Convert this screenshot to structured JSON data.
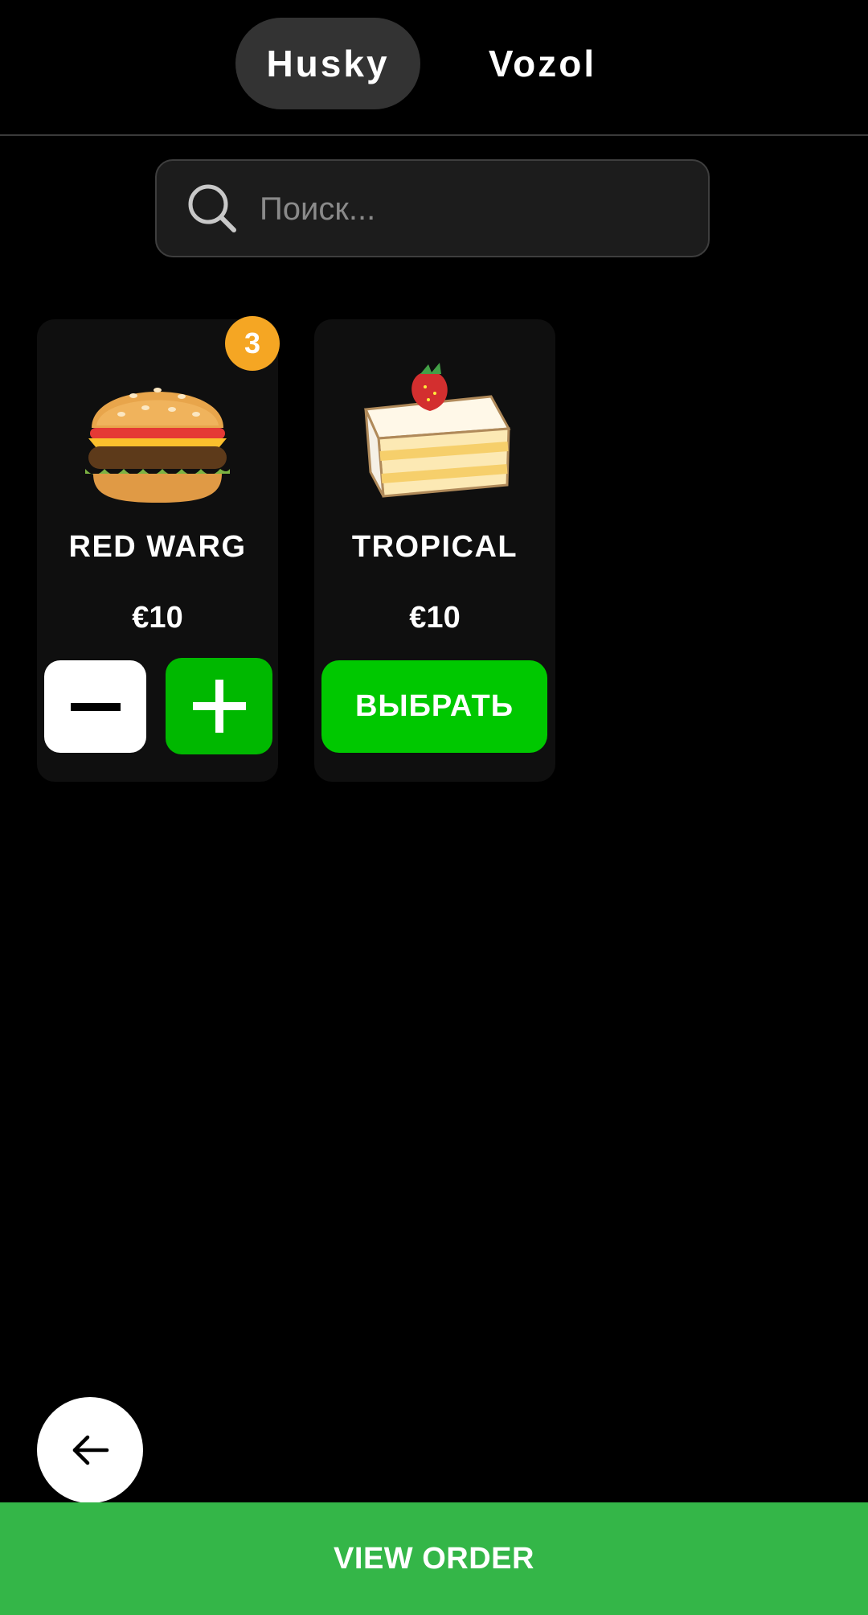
{
  "tabs": [
    {
      "label": "Husky",
      "active": true
    },
    {
      "label": "Vozol",
      "active": false
    }
  ],
  "search": {
    "placeholder": "Поиск...",
    "value": ""
  },
  "products": [
    {
      "name": "RED WARG",
      "price": "€10",
      "image": "burger",
      "quantity": "3",
      "action": "stepper"
    },
    {
      "name": "TROPICAL",
      "price": "€10",
      "image": "cake-slice",
      "action": "select",
      "select_label": "ВЫБРАТЬ"
    }
  ],
  "colors": {
    "badge": "#f5a623",
    "plus_button": "#00b800",
    "select_button": "#00c800",
    "view_order_bar": "#34b648"
  },
  "footer": {
    "view_order_label": "VIEW ORDER"
  }
}
